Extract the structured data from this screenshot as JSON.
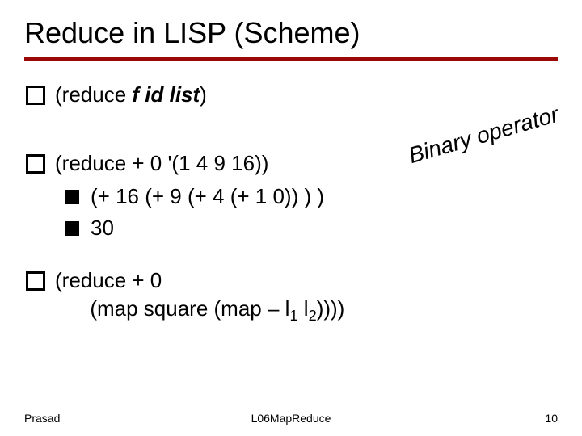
{
  "title": "Reduce in LISP (Scheme)",
  "items": {
    "i1_pre": "(reduce ",
    "i1_ital": "f id list",
    "i1_post": ")",
    "i2": "(reduce + 0 '(1 4 9 16))",
    "i2a": "(+ 16 (+ 9 (+ 4 (+ 1 0)) ) )",
    "i2b": "30",
    "i3_line1": "(reduce + 0",
    "i3_line2_pre": "      (map square (map – l",
    "i3_line2_sub1": "1",
    "i3_line2_mid": " l",
    "i3_line2_sub2": "2",
    "i3_line2_post": "))))"
  },
  "annotation": "Binary operator",
  "footer": {
    "left": "Prasad",
    "center": "L06MapReduce",
    "right": "10"
  }
}
